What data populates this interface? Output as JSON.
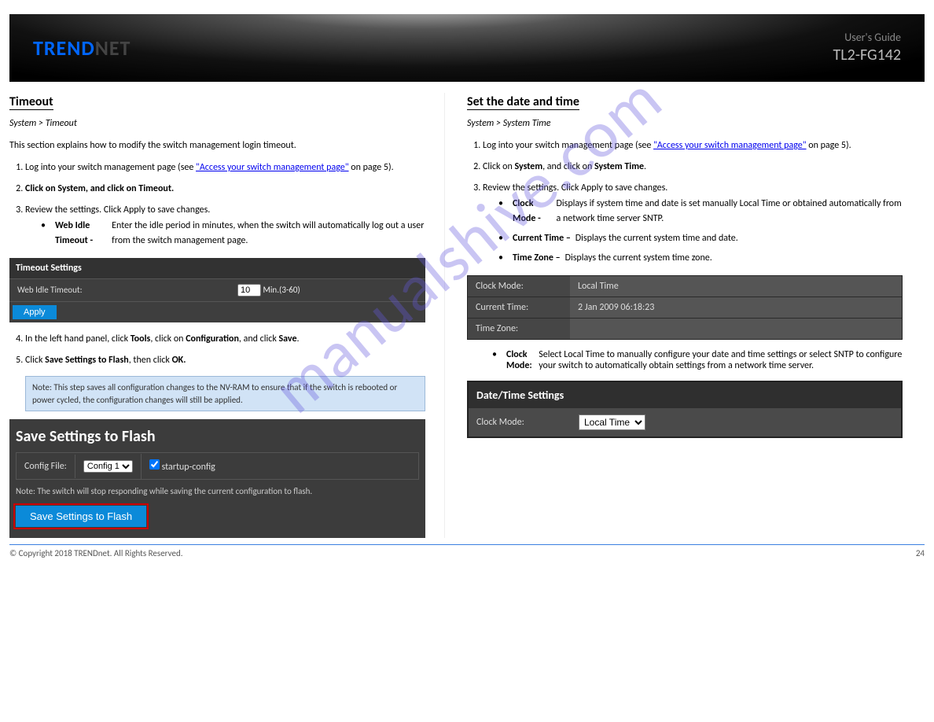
{
  "brand_tr": "TREND",
  "brand_end": "NET",
  "banner_sub": "User's Guide",
  "banner_model": "TL2-FG142",
  "watermark": "manualshive.com",
  "left": {
    "section": "Timeout",
    "path": "System > Timeout",
    "p1_prefix": "This section explains how to modify the switch management login timeout.",
    "p2": "Log into your switch management page (see ",
    "p2_link": "\"Access your switch management page\"",
    "p2_after": " on page 5).",
    "step2": "Click on System, and click on Timeout.",
    "step3": "Review the settings. Click Apply to save changes.",
    "bullet_lbl": "Web Idle Timeout -",
    "bullet_txt": " Enter the idle period in minutes, when the switch will automatically log out a user from the switch management page.",
    "panel_title": "Timeout Settings",
    "timeout_lbl": "Web Idle Timeout:",
    "timeout_val": "10",
    "timeout_unit": "Min.(3-60)",
    "apply": "Apply",
    "step4_a": "In the left hand panel, click ",
    "step4_b": "Tools",
    "step4_c": ", click on ",
    "step4_d": "Configuration",
    "step4_e": ", and click ",
    "step4_f": "Save",
    "step4_g": ".",
    "step5_a": "Click ",
    "step5_b": "Save Settings to Flash",
    "step5_c": ", then click ",
    "step5_d": "OK.",
    "note": "Note: This step saves all configuration changes to the NV-RAM to ensure that if the switch is rebooted or power cycled, the configuration changes will still be applied.",
    "flash_title": "Save Settings to Flash",
    "flash_cfg": "Config File:",
    "flash_cfg_val": "Config 1",
    "flash_startup": "startup-config",
    "flash_note": "Note: The switch will stop responding while saving the current configuration to flash.",
    "flash_btn": "Save Settings to Flash"
  },
  "right": {
    "section": "Set the date and time",
    "path": "System > System Time",
    "step1_prefix": "Log into your switch management page (see ",
    "step1_link": "\"Access your switch management page\"",
    "step1_after": " on page 5).",
    "step2": "Click on System, and click on System Time.",
    "step3": "Review the settings. Click Apply to save changes.",
    "clk_mode_lbl": "Clock Mode -",
    "clk_mode_txt": " Displays if system time and date is set manually Local Time or obtained automatically from a network time server SNTP.",
    "cur_time_lbl": "Current Time –",
    "cur_time_txt": " Displays the current system time and date.",
    "tz_lbl": "Time Zone –",
    "tz_txt": " Displays the current system time zone.",
    "tbl_clock_mode": "Clock Mode:",
    "tbl_clock_mode_val": "Local Time",
    "tbl_cur": "Current Time:",
    "tbl_cur_val": "2 Jan 2009 06:18:23",
    "tbl_tz": "Time Zone:",
    "tbl_tz_val": "",
    "bullet2_lbl": "Clock Mode:",
    "bullet2_txt": " Select Local Time to manually configure your date and time settings or select SNTP to configure your switch to automatically obtain settings from a network time server.",
    "dt_hdr": "Date/Time Settings",
    "dt_row_lbl": "Clock Mode:",
    "dt_row_val": "Local Time"
  },
  "footer": {
    "copy": "© Copyright 2018 TRENDnet. All Rights Reserved.",
    "page": "24"
  }
}
